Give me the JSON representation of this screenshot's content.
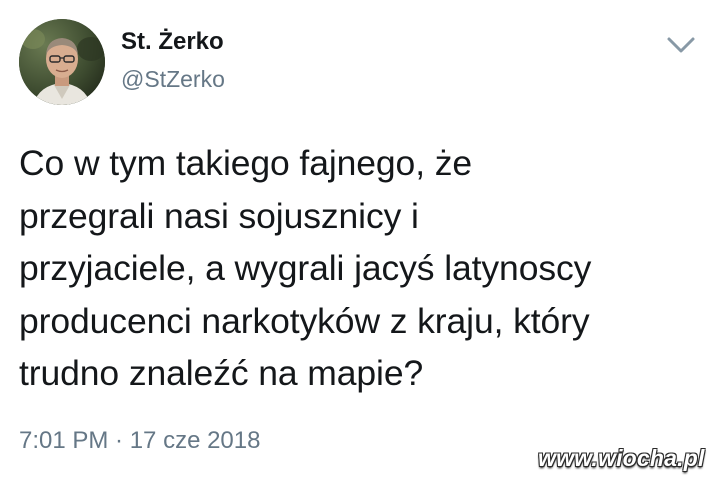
{
  "author": {
    "display_name": "St. Żerko",
    "username": "@StZerko",
    "avatar": "profile-photo"
  },
  "header": {
    "menu_icon": "chevron-down-icon"
  },
  "tweet": {
    "lines": [
      "Co w tym takiego fajnego, że",
      "przegrali nasi sojusznicy i",
      "przyjaciele, a wygrali jacyś latynoscy",
      "producenci narkotyków z kraju, który",
      "trudno znaleźć na mapie?"
    ],
    "timestamp": "7:01 PM · 17 cze 2018"
  },
  "watermark": {
    "text": "www.wiocha.pl"
  },
  "colors": {
    "text": "#14171a",
    "secondary": "#657786",
    "caret": "#8899a6",
    "background": "#ffffff"
  }
}
